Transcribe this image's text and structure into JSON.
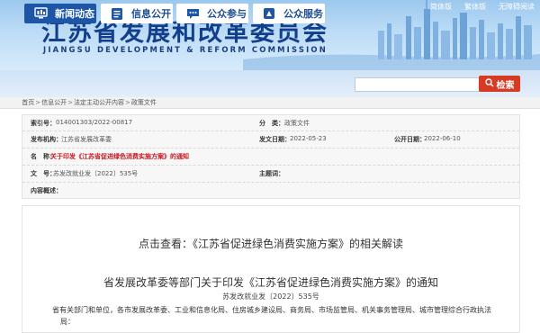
{
  "site": {
    "title": "江苏省发展和改革委员会",
    "subtitle": "JIANGSU DEVELOPMENT & REFORM COMMISSION",
    "top_links": [
      "简体版",
      "繁体版",
      "无障碍阅读"
    ]
  },
  "nav": {
    "items": [
      {
        "label": "新闻动态",
        "icon": "monitor-icon"
      },
      {
        "label": "信息公开",
        "icon": "document-icon"
      },
      {
        "label": "公众参与",
        "icon": "chat-icon"
      },
      {
        "label": "公众服务",
        "icon": "service-icon"
      }
    ],
    "search_placeholder": "",
    "search_label": "检索"
  },
  "breadcrumb": [
    "首页",
    "信息公开",
    "法定主动公开内容",
    "政策文件"
  ],
  "info": {
    "index_no_label": "索引号：",
    "index_no": "014001303/2022-00817",
    "category_label": "分　类：",
    "category": "政策文件",
    "publisher_label": "发布机构：",
    "publisher": "江苏省发展改革委",
    "publish_date_label": "发文日期：",
    "publish_date": "2022-05-23",
    "release_date_label": "公开日期：",
    "release_date": "2022-06-10",
    "name_label": "名　称：",
    "name": "关于印发《江苏省促进绿色消费实施方案》的通知",
    "doc_no_label": "文　号：",
    "doc_no": "苏发改就业发〔2022〕535号",
    "keywords_label": "主题词：",
    "keywords": "",
    "summary_label": "内容概述：",
    "summary": ""
  },
  "article": {
    "interpretation_prefix": "点击查看：",
    "interpretation_link": "《江苏省促进绿色消费实施方案》的相关解读",
    "title": "省发展改革委等部门关于印发《江苏省促进绿色消费实施方案》的通知",
    "doc_no": "苏发改就业发〔2022〕535号",
    "para1": "省有关部门和单位，各市发展改革委、工业和信息化局、住房城乡建设局、商务局、市场监管局、机关事务管理局、城市管理综合行政执法",
    "para2": "局："
  },
  "colors": {
    "nav_active": "#1d56a7",
    "search_button": "#d73a22",
    "name_text": "#c9151e",
    "site_title": "#123f8c"
  }
}
